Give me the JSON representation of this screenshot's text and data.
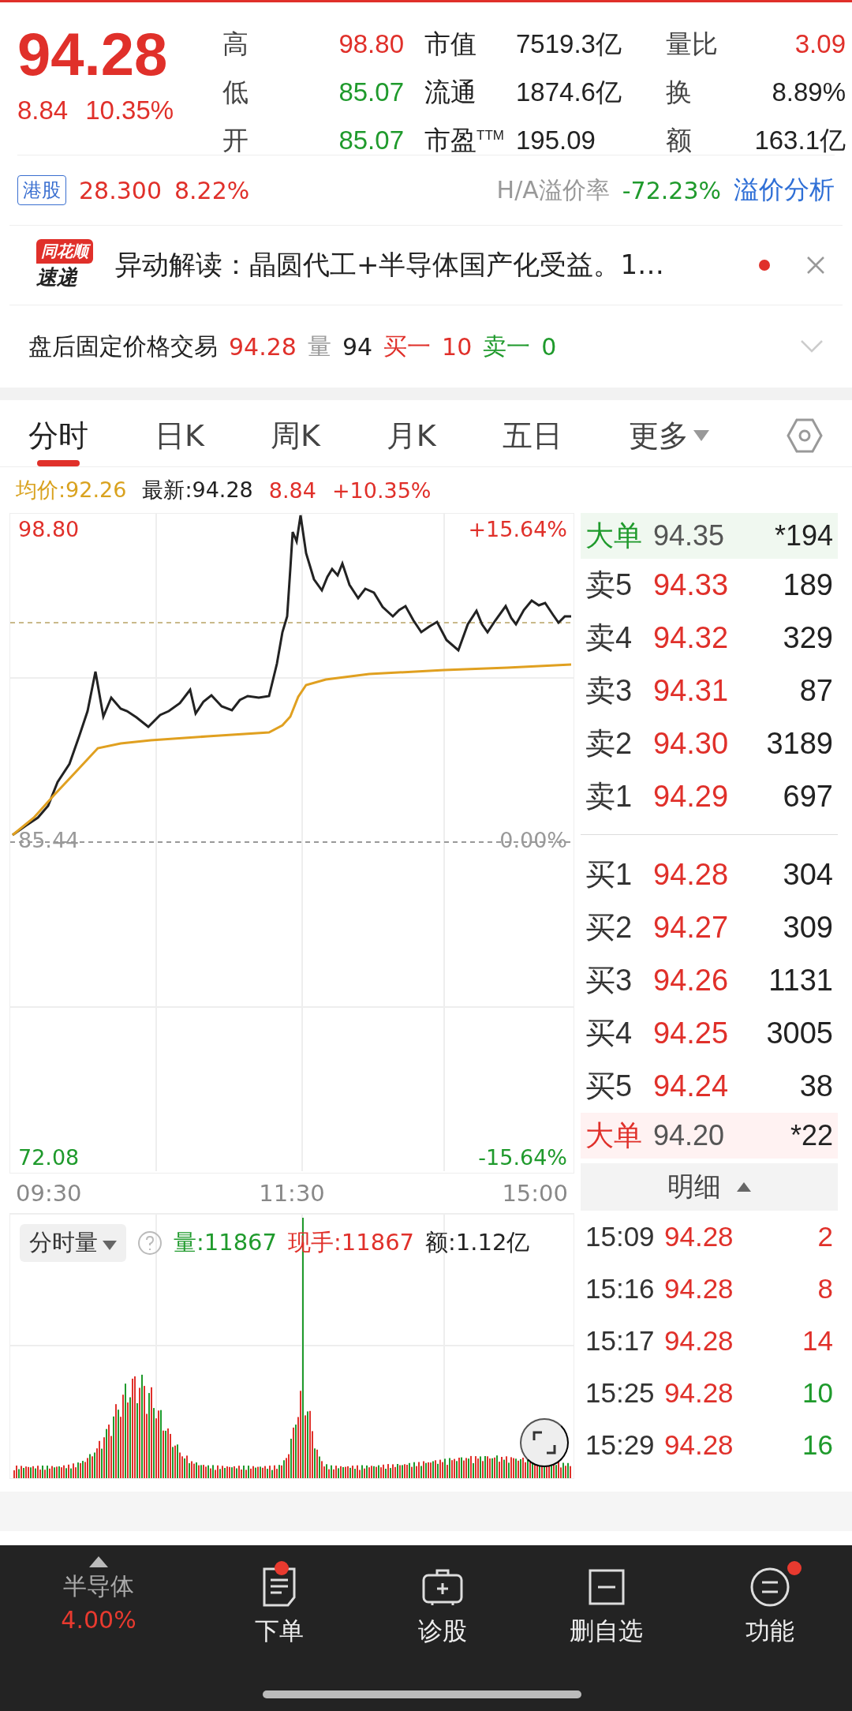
{
  "quote": {
    "price": "94.28",
    "change": "8.84",
    "percent": "10.35%"
  },
  "stats": [
    {
      "label": "高",
      "value": "98.80",
      "color": "#e0302a",
      "label2": "市值",
      "value2": "7519.3亿",
      "label3": "量比",
      "value3": "3.09"
    },
    {
      "label": "低",
      "value": "85.07",
      "color": "#1f9a2c",
      "label2": "流通",
      "value2": "1874.6亿",
      "label3": "换",
      "value3": "8.89%"
    },
    {
      "label": "开",
      "value": "85.07",
      "color": "#1f9a2c",
      "label2": "市盈$^{TTM}$",
      "value2": "195.09",
      "label3": "额",
      "value3": "163.1亿"
    }
  ],
  "hk": {
    "tag": "港股",
    "price": "28.300",
    "percent": "8.22%",
    "premium_label": "H/A溢价率",
    "premium": "-72.23%",
    "link": "溢价分析"
  },
  "news": {
    "logo_top": "同花顺",
    "logo_bottom": "速递",
    "text": "异动解读：晶圆代工+半导体国产化受益。1…",
    "unread": true
  },
  "after_hours": {
    "label": "盘后固定价格交易",
    "price": "94.28",
    "vol_label": "量",
    "vol": "94",
    "buy_label": "买一",
    "buy": "10",
    "sell_label": "卖一",
    "sell": "0"
  },
  "tabs": [
    {
      "label": "分时",
      "selected": true
    },
    {
      "label": "日K",
      "selected": false
    },
    {
      "label": "周K",
      "selected": false
    },
    {
      "label": "月K",
      "selected": false
    },
    {
      "label": "五日",
      "selected": false
    },
    {
      "label": "更多",
      "selected": false,
      "dropdown": true
    }
  ],
  "info": {
    "avg": "均价:92.26",
    "latest": "最新:94.28",
    "change": "8.84",
    "percent": "+10.35%"
  },
  "chart": {
    "high": "98.80",
    "high_pct": "+15.64%",
    "base": "85.44",
    "base_pct": "0.00%",
    "low": "72.08",
    "low_pct": "-15.64%",
    "times": [
      "09:30",
      "11:30",
      "15:00"
    ]
  },
  "volume": {
    "selector": "分时量",
    "vol": "量:11867",
    "hand": "现手:11867",
    "amount": "额:1.12亿"
  },
  "book": [
    {
      "kind": "big",
      "label": "大单",
      "price": "94.35",
      "qty": "*194",
      "color": "#1f9a2c"
    },
    {
      "kind": "level",
      "label": "卖5",
      "price": "94.33",
      "qty": "189"
    },
    {
      "kind": "level",
      "label": "卖4",
      "price": "94.32",
      "qty": "329"
    },
    {
      "kind": "level",
      "label": "卖3",
      "price": "94.31",
      "qty": "87"
    },
    {
      "kind": "level",
      "label": "卖2",
      "price": "94.30",
      "qty": "3189"
    },
    {
      "kind": "level",
      "label": "卖1",
      "price": "94.29",
      "qty": "697"
    },
    {
      "kind": "divider"
    },
    {
      "kind": "level",
      "label": "买1",
      "price": "94.28",
      "qty": "304"
    },
    {
      "kind": "level",
      "label": "买2",
      "price": "94.27",
      "qty": "309"
    },
    {
      "kind": "level",
      "label": "买3",
      "price": "94.26",
      "qty": "1131"
    },
    {
      "kind": "level",
      "label": "买4",
      "price": "94.25",
      "qty": "3005"
    },
    {
      "kind": "level",
      "label": "买5",
      "price": "94.24",
      "qty": "38"
    },
    {
      "kind": "big",
      "label": "大单",
      "price": "94.20",
      "qty": "*22",
      "color": "#e0302a"
    }
  ],
  "detail_header": "明细",
  "trades": [
    {
      "time": "15:09",
      "price": "94.28",
      "qty": "2",
      "color": "#e0302a"
    },
    {
      "time": "15:16",
      "price": "94.28",
      "qty": "8",
      "color": "#e0302a"
    },
    {
      "time": "15:17",
      "price": "94.28",
      "qty": "14",
      "color": "#e0302a"
    },
    {
      "time": "15:25",
      "price": "94.28",
      "qty": "10",
      "color": "#1f9a2c"
    },
    {
      "time": "15:29",
      "price": "94.28",
      "qty": "16",
      "color": "#1f9a2c"
    }
  ],
  "nav": {
    "sector": {
      "name": "半导体",
      "percent": "4.00%"
    },
    "items": [
      {
        "kind": "order",
        "label": "下单",
        "badge": true
      },
      {
        "kind": "diagnose",
        "label": "诊股",
        "badge": false
      },
      {
        "kind": "remove",
        "label": "删自选",
        "badge": false
      },
      {
        "kind": "functions",
        "label": "功能",
        "badge": true
      }
    ]
  }
}
